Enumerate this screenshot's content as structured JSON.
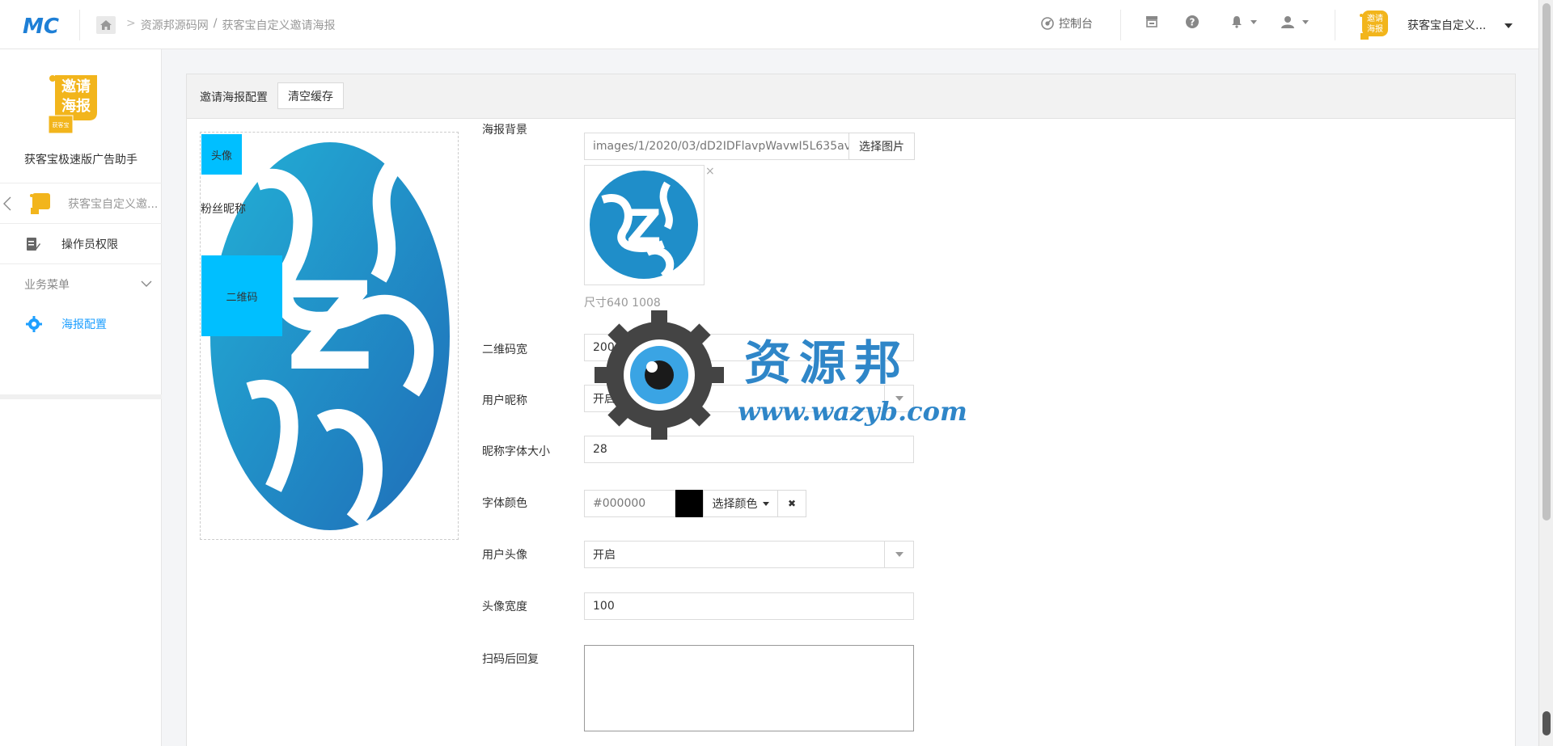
{
  "header": {
    "brand": "MC",
    "breadcrumb": [
      "资源邦源码网",
      "/",
      "获客宝自定义邀请海报"
    ],
    "nav": {
      "console": "控制台"
    },
    "user_name": "获客宝自定义...",
    "avatar_text_top": "邀请",
    "avatar_text_bottom": "海报"
  },
  "sidebar": {
    "logo_text_top": "邀请",
    "logo_text_bottom": "海报",
    "logo_badge": "获客宝",
    "app_name": "获客宝极速版广告助手",
    "back_label": "获客宝自定义邀...",
    "operator_permission": "操作员权限",
    "business_menu": "业务菜单",
    "poster_config": "海报配置"
  },
  "panel": {
    "tab_title": "邀请海报配置",
    "clear_cache": "清空缓存"
  },
  "preview": {
    "avatar": "头像",
    "nickname": "粉丝昵称",
    "qrcode": "二维码"
  },
  "form": {
    "bg_label": "海报背景",
    "bg_value": "images/1/2020/03/dD2IDFlavpWavwI5L635av",
    "choose_image": "选择图片",
    "close_x": "×",
    "size_hint": "尺寸640 1008",
    "qr_width_label": "二维码宽",
    "qr_width_value": "200",
    "nickname_label": "用户昵称",
    "nickname_value": "开启",
    "nick_font_label": "昵称字体大小",
    "nick_font_value": "28",
    "font_color_label": "字体颜色",
    "font_color_value": "#000000",
    "choose_color": "选择颜色",
    "clear_color": "✖",
    "avatar_label": "用户头像",
    "avatar_value": "开启",
    "avatar_width_label": "头像宽度",
    "avatar_width_value": "100",
    "reply_label": "扫码后回复",
    "reply_value": ""
  },
  "watermark": {
    "title": "资源邦",
    "url": "www.wazyb.com"
  },
  "colors": {
    "accent": "#1e9fff",
    "preview_block": "#00bfff",
    "poster_blue": "#1f8ec9",
    "logo_yellow": "#f2b51c",
    "font_color_swatch": "#000000"
  },
  "icons": [
    "home-icon",
    "dashboard-icon",
    "store-icon",
    "help-icon",
    "bell-icon",
    "user-icon",
    "chevron-left-icon",
    "edit-icon",
    "chevron-down-icon",
    "gear-icon"
  ]
}
